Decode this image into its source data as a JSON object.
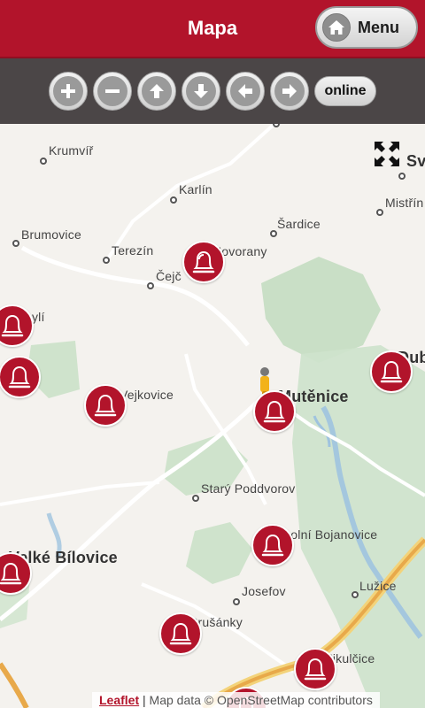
{
  "header": {
    "title": "Mapa",
    "menu_label": "Menu"
  },
  "toolbar": {
    "online_label": "online",
    "buttons": [
      {
        "name": "zoom-in",
        "icon": "plus-icon"
      },
      {
        "name": "zoom-out",
        "icon": "minus-icon"
      },
      {
        "name": "pan-up",
        "icon": "arrow-up-icon"
      },
      {
        "name": "pan-down",
        "icon": "arrow-down-icon"
      },
      {
        "name": "pan-left",
        "icon": "arrow-left-icon"
      },
      {
        "name": "pan-right",
        "icon": "arrow-right-icon"
      }
    ]
  },
  "map": {
    "places": {
      "krumvir": "Krumvíř",
      "karlin": "Karlín",
      "brumovice": "Brumovice",
      "terezin": "Terezín",
      "cejc": "Čejč",
      "sardice": "Šardice",
      "mistrin": "Mistřín",
      "svatobor_partial": "Sv",
      "hovorany": "Hovorany",
      "obyli_partial": "obylí",
      "vejkovice": "Vejkovice",
      "mutenice": "Mutěnice",
      "dub_partial": "Dub",
      "stary_poddvorov": "Starý Poddvorov",
      "velke_bilovice": "Velké Bílovice",
      "dolni_bojanovice": "Dolní Bojanovice",
      "josefov": "Josefov",
      "luzice": "Lužice",
      "prusanky": "Prušánky",
      "mikulcice": "Mikulčice"
    },
    "attribution": {
      "leaflet": "Leaflet",
      "separator": " | ",
      "text": "Map data © OpenStreetMap contributors"
    },
    "colors": {
      "brand_red": "#b2142b",
      "forest": "#c9dfc6",
      "water": "#9fc3df",
      "road_orange": "#e8a94a",
      "road_yellow": "#f3d37a"
    }
  }
}
